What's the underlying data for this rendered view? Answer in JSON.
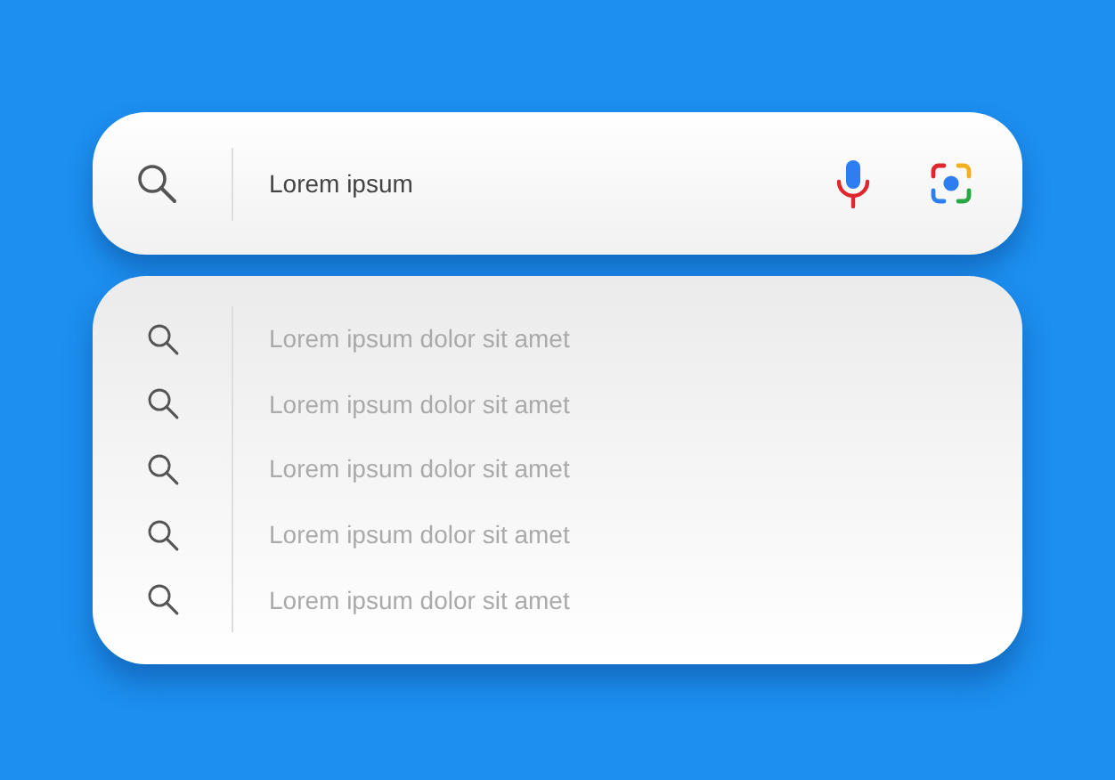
{
  "search": {
    "value": "Lorem ipsum"
  },
  "suggestions": [
    {
      "label": "Lorem ipsum dolor sit amet"
    },
    {
      "label": "Lorem ipsum dolor sit amet"
    },
    {
      "label": "Lorem ipsum dolor sit amet"
    },
    {
      "label": "Lorem ipsum dolor sit amet"
    },
    {
      "label": "Lorem ipsum dolor sit amet"
    }
  ]
}
